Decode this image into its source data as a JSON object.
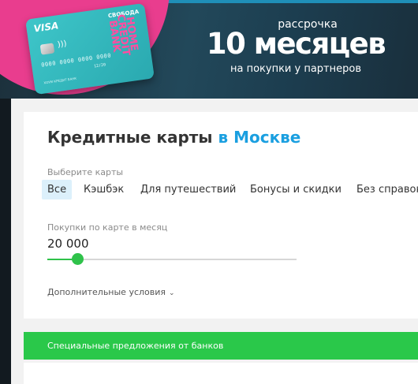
{
  "banner": {
    "card": {
      "network": "VISA",
      "brand": "СВОБОДА",
      "number": "0000 0000 0000 0000",
      "expiry": "12/20",
      "bank": "ХОУМ КРЕДИТ БАНК",
      "stack_text": "HOME CREDIT BANK",
      "contactless": "))))"
    },
    "promo_small": "рассрочка",
    "promo_big": "10 месяцев",
    "promo_sub": "на покупки у партнеров",
    "colors": {
      "pink": "#e93d8e",
      "card": "#3ec6c9",
      "background": "#22485a"
    }
  },
  "page": {
    "title": "Кредитные карты",
    "title_city": "в Москве",
    "filters_label": "Выберите карты",
    "filters": [
      {
        "label": "Все",
        "active": true
      },
      {
        "label": "Кэшбэк",
        "active": false
      },
      {
        "label": "Для путешествий",
        "active": false
      },
      {
        "label": "Бонусы и скидки",
        "active": false
      },
      {
        "label": "Без справок",
        "active": false
      }
    ],
    "spend_label": "Покупки по карте в месяц",
    "spend_value": "20 000",
    "spend_slider_fraction": 0.12,
    "more_conditions": "Дополнительные условия",
    "chevron_icon": "chevron-down-icon",
    "offers_bar": "Специальные предложения от банков",
    "colors": {
      "accent": "#1a9fe0",
      "green": "#2ac84a",
      "chip_active": "#dcf0fb"
    }
  }
}
